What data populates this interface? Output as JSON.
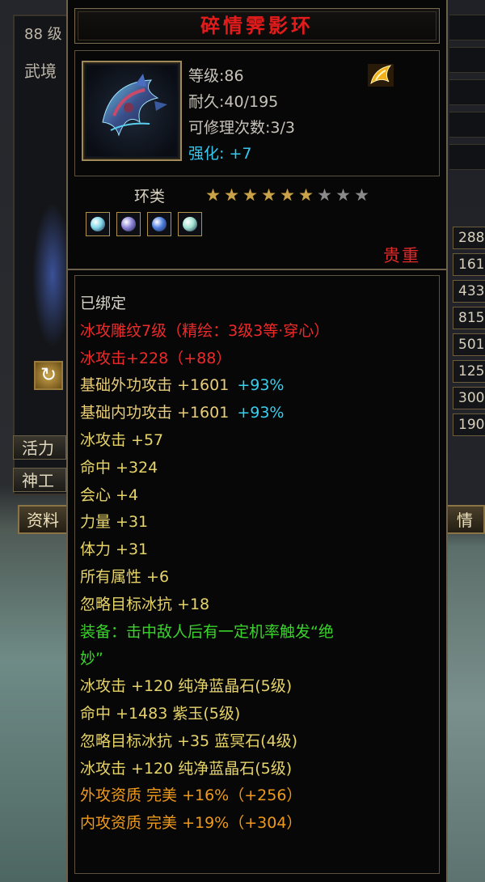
{
  "background": {
    "level_text": "88 级",
    "realm_text": "武境",
    "left_buttons": [
      "活力",
      "神工"
    ],
    "tabs": [
      "资料",
      "情"
    ],
    "right_stats": [
      "288",
      "161",
      "433",
      "815",
      "501",
      "125",
      "300",
      "190"
    ]
  },
  "item": {
    "name": "碎情霁影环",
    "level": "等级:86",
    "durability": "耐久:40/195",
    "repairs": "可修理次数:3/3",
    "enhance_label": "强化:",
    "enhance_value": "+7",
    "type": "环类",
    "stars_on": 6,
    "stars_total": 9,
    "precious": "贵重",
    "sockets": [
      {
        "icon": "cyan-gem-icon",
        "color": "#7fd7e8"
      },
      {
        "icon": "violet-gem-icon",
        "color": "#8b82d6"
      },
      {
        "icon": "blue-gem-icon",
        "color": "#4f7fe0"
      },
      {
        "icon": "jade-gem-icon",
        "color": "#9fe0cf"
      }
    ]
  },
  "attributes": [
    {
      "text": "已绑定",
      "color": "white"
    },
    {
      "text": "冰攻雕纹7级（精绘：3级3等·穿心）",
      "color": "red"
    },
    {
      "text": "冰攻击+228（+88）",
      "color": "red"
    },
    {
      "text": "基础外功攻击 +1601",
      "extra": "+93%",
      "color": "gold"
    },
    {
      "text": "基础内功攻击 +1601",
      "extra": "+93%",
      "color": "gold"
    },
    {
      "text": "冰攻击 +57",
      "color": "yellow"
    },
    {
      "text": "命中 +324",
      "color": "yellow"
    },
    {
      "text": "会心 +4",
      "color": "yellow"
    },
    {
      "text": "力量 +31",
      "color": "yellow"
    },
    {
      "text": "体力 +31",
      "color": "yellow"
    },
    {
      "text": "所有属性 +6",
      "color": "yellow"
    },
    {
      "text": "忽略目标冰抗 +18",
      "color": "yellow"
    },
    {
      "text": "装备：击中敌人后有一定机率触发“绝",
      "color": "green"
    },
    {
      "text": "妙”",
      "color": "green"
    },
    {
      "text": "冰攻击 +120 纯净蓝晶石(5级)",
      "color": "yellow"
    },
    {
      "text": "命中 +1483 紫玉(5级)",
      "color": "yellow"
    },
    {
      "text": "忽略目标冰抗 +35 蓝冥石(4级)",
      "color": "yellow"
    },
    {
      "text": "冰攻击 +120 纯净蓝晶石(5级)",
      "color": "yellow"
    },
    {
      "text": "外攻资质  完美 +16%（+256）",
      "color": "orange"
    },
    {
      "text": "内攻资质  完美 +19%（+304）",
      "color": "orange"
    }
  ]
}
